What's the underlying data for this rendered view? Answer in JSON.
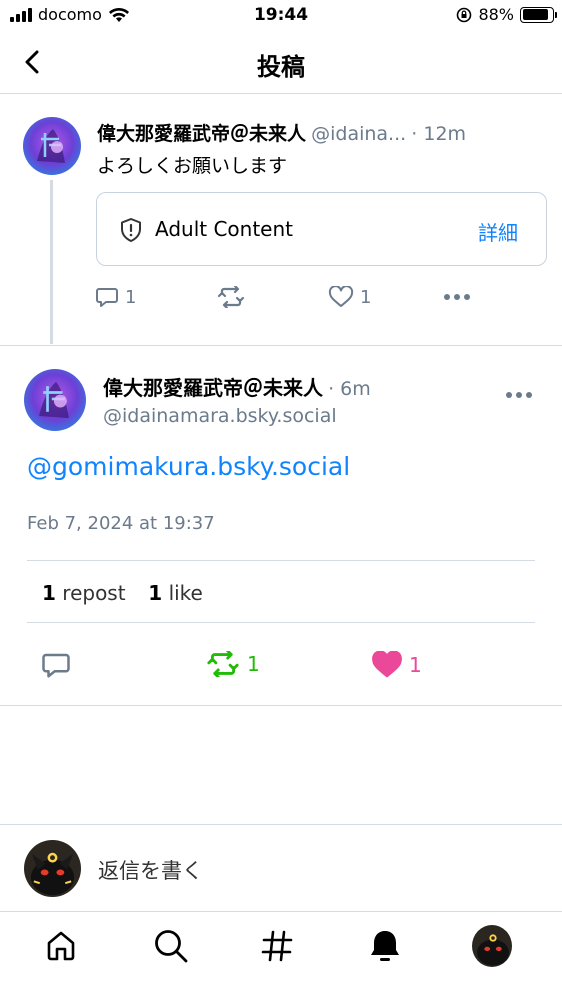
{
  "status_bar": {
    "carrier": "docomo",
    "time": "19:44",
    "battery": "88%",
    "battery_level": 0.88
  },
  "header": {
    "title": "投稿"
  },
  "parent_post": {
    "display_name": "偉大那愛羅武帝＠未来人",
    "handle": "@idaina...",
    "time": "· 12m",
    "text": "よろしくお願いします",
    "content_warning": {
      "label": "Adult Content",
      "details_label": "詳細"
    },
    "replies": "1",
    "likes": "1"
  },
  "main_post": {
    "display_name": "偉大那愛羅武帝＠未来人",
    "time": "· 6m",
    "handle": "@idainamara.bsky.social",
    "mention": "@gomimakura.bsky.social",
    "date": "Feb 7, 2024 at 19:37",
    "repost_count": "1",
    "repost_label": "repost",
    "like_count": "1",
    "like_label": "like",
    "action_reposts": "1",
    "action_likes": "1"
  },
  "reply_bar": {
    "placeholder": "返信を書く"
  },
  "tabs": [
    "home",
    "search",
    "feeds",
    "notifications",
    "profile"
  ],
  "colors": {
    "accent": "#1083fe",
    "repost_green": "#20bc07",
    "like_pink": "#ec4899",
    "muted": "#6b7b8c"
  }
}
